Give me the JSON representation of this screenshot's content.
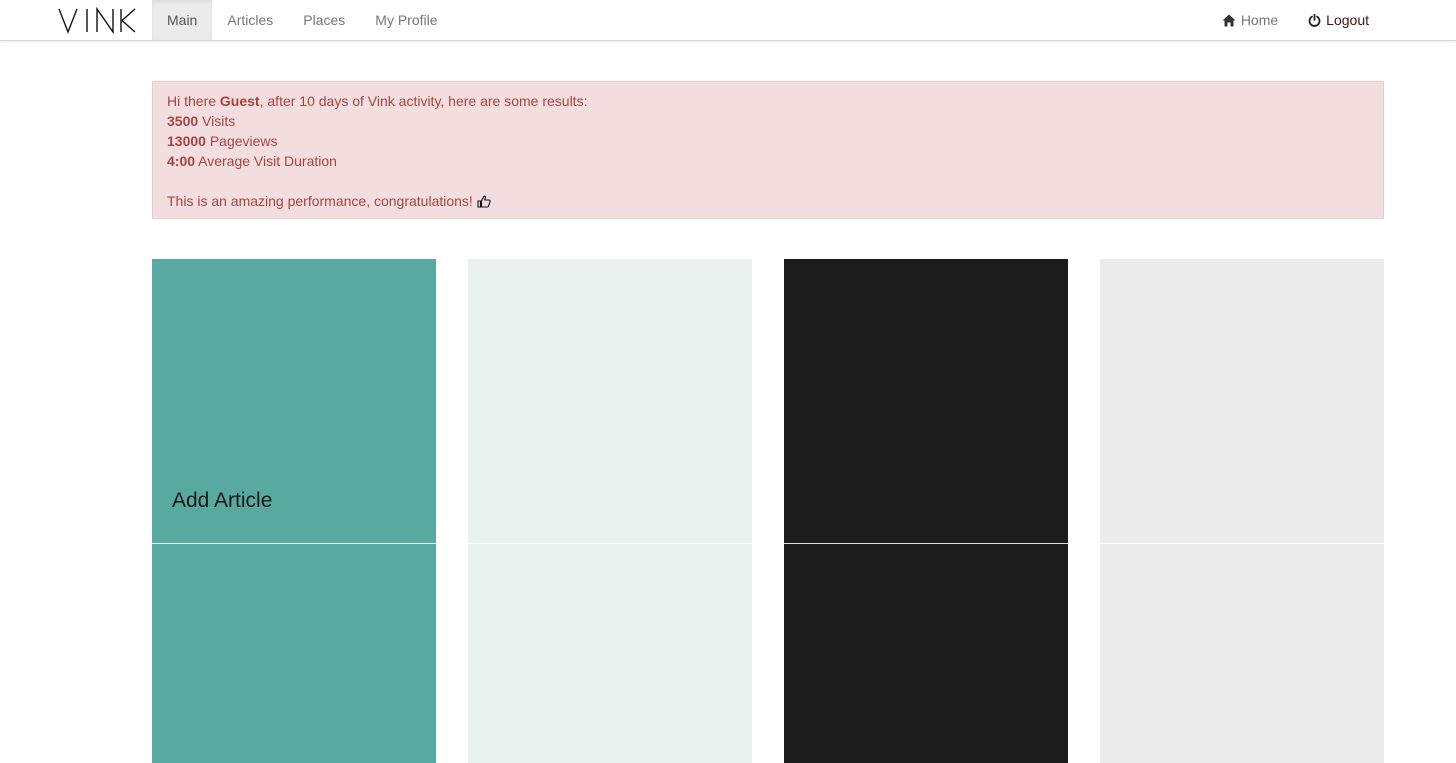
{
  "brand": {
    "logo_text": "VINK"
  },
  "nav": {
    "items": [
      {
        "label": "Main",
        "active": true
      },
      {
        "label": "Articles",
        "active": false
      },
      {
        "label": "Places",
        "active": false
      },
      {
        "label": "My Profile",
        "active": false
      }
    ],
    "right": {
      "home_label": "Home",
      "logout_label": "Logout"
    }
  },
  "alert": {
    "greeting_prefix": "Hi there ",
    "user_name": "Guest",
    "greeting_suffix": ", after 10 days of Vink activity, here are some results:",
    "stats": [
      {
        "value": "3500",
        "label": " Visits"
      },
      {
        "value": "13000",
        "label": " Pageviews"
      },
      {
        "value": "4:00",
        "label": " Average Visit Duration"
      }
    ],
    "closing": "This is an amazing performance, congratulations!",
    "closing_icon": "thumbs-up-icon"
  },
  "tiles": [
    {
      "label": "Add Article",
      "color": "#58a9a0"
    },
    {
      "label": "",
      "color": "#eaf1ef"
    },
    {
      "label": "",
      "color": "#1b1b1b"
    },
    {
      "label": "",
      "color": "#ececec"
    }
  ],
  "colors": {
    "alert_bg": "#f2dede",
    "alert_text": "#a94442",
    "nav_active_bg": "#ebebeb"
  }
}
